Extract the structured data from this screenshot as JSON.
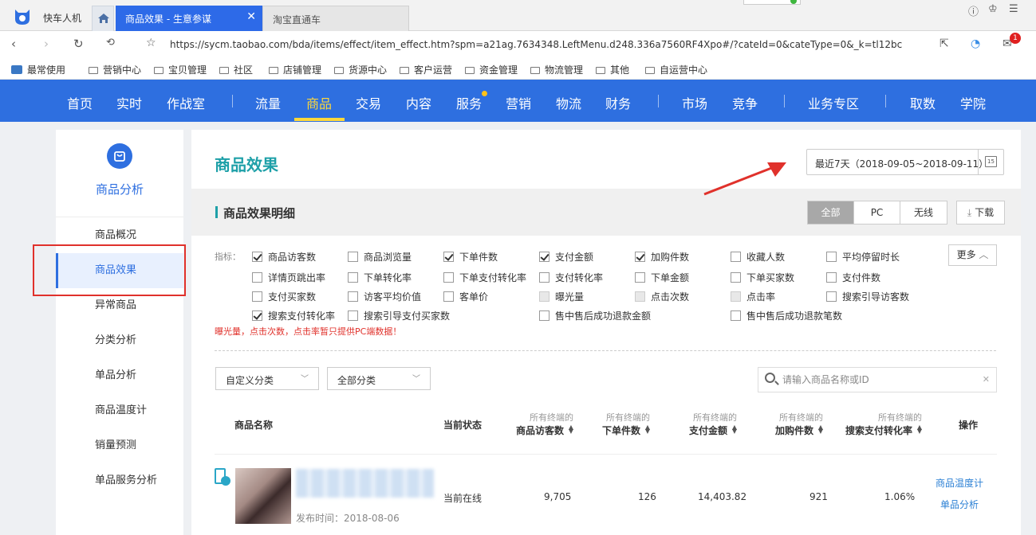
{
  "browser": {
    "app_name": "快车人机",
    "active_tab": "商品效果 - 生意参谋",
    "inactive_tab": "淘宝直通车",
    "url": "https://sycm.taobao.com/bda/items/effect/item_effect.htm?spm=a21ag.7634348.LeftMenu.d248.336a7560RF4Xpo#/?cateId=0&cateType=0&_k=tl12bc",
    "mail_badge": "1",
    "bookmarks": [
      "最常使用",
      "营销中心",
      "宝贝管理",
      "社区",
      "店铺管理",
      "货源中心",
      "客户运营",
      "资金管理",
      "物流管理",
      "其他",
      "自运营中心"
    ]
  },
  "topnav": {
    "items": [
      "首页",
      "实时",
      "作战室",
      "流量",
      "商品",
      "交易",
      "内容",
      "服务",
      "营销",
      "物流",
      "财务",
      "市场",
      "竞争",
      "业务专区",
      "取数",
      "学院"
    ],
    "active": "商品"
  },
  "sidebar": {
    "title": "商品分析",
    "items": [
      "商品概况",
      "商品效果",
      "异常商品",
      "分类分析",
      "单品分析",
      "商品温度计",
      "销量预测",
      "单品服务分析"
    ],
    "active_index": 1
  },
  "main": {
    "title": "商品效果",
    "date_range": "最近7天（2018-09-05~2018-09-11）",
    "calendar_number": "15",
    "section_title": "商品效果明细",
    "segments": [
      "全部",
      "PC",
      "无线"
    ],
    "download": "下载",
    "indicator_label": "指标：",
    "more": "更多",
    "checkboxes": [
      {
        "label": "商品访客数",
        "checked": true
      },
      {
        "label": "商品浏览量",
        "checked": false
      },
      {
        "label": "下单件数",
        "checked": true
      },
      {
        "label": "支付金额",
        "checked": true
      },
      {
        "label": "加购件数",
        "checked": true
      },
      {
        "label": "收藏人数",
        "checked": false
      },
      {
        "label": "平均停留时长",
        "checked": false
      },
      {
        "label": "详情页跳出率",
        "checked": false
      },
      {
        "label": "下单转化率",
        "checked": false
      },
      {
        "label": "下单支付转化率",
        "checked": false
      },
      {
        "label": "支付转化率",
        "checked": false
      },
      {
        "label": "下单金额",
        "checked": false
      },
      {
        "label": "下单买家数",
        "checked": false
      },
      {
        "label": "支付件数",
        "checked": false
      },
      {
        "label": "支付买家数",
        "checked": false
      },
      {
        "label": "访客平均价值",
        "checked": false
      },
      {
        "label": "客单价",
        "checked": false
      },
      {
        "label": "曝光量",
        "checked": false,
        "disabled": true
      },
      {
        "label": "点击次数",
        "checked": false,
        "disabled": true
      },
      {
        "label": "点击率",
        "checked": false,
        "disabled": true
      },
      {
        "label": "搜索引导访客数",
        "checked": false
      },
      {
        "label": "搜索支付转化率",
        "checked": true
      },
      {
        "label": "搜索引导支付买家数",
        "checked": false
      },
      {
        "label": "售中售后成功退款金额",
        "checked": false
      },
      {
        "label": "售中售后成功退款笔数",
        "checked": false
      }
    ],
    "warning": "曝光量，点击次数，点击率暂只提供PC端数据！",
    "filter1": "自定义分类",
    "filter2": "全部分类",
    "search_placeholder": "请输入商品名称或ID",
    "table": {
      "headers": {
        "name": "商品名称",
        "status": "当前状态",
        "prefix": "所有终端的",
        "visitors": "商品访客数",
        "orders": "下单件数",
        "payment": "支付金额",
        "cart": "加购件数",
        "search_conv": "搜索支付转化率",
        "ops": "操作"
      },
      "rows": [
        {
          "publish": "发布时间：2018-08-06",
          "status": "当前在线",
          "visitors": "9,705",
          "orders": "126",
          "payment": "14,403.82",
          "cart": "921",
          "search_conv": "1.06%",
          "op1": "商品温度计",
          "op2": "单品分析"
        }
      ]
    }
  }
}
